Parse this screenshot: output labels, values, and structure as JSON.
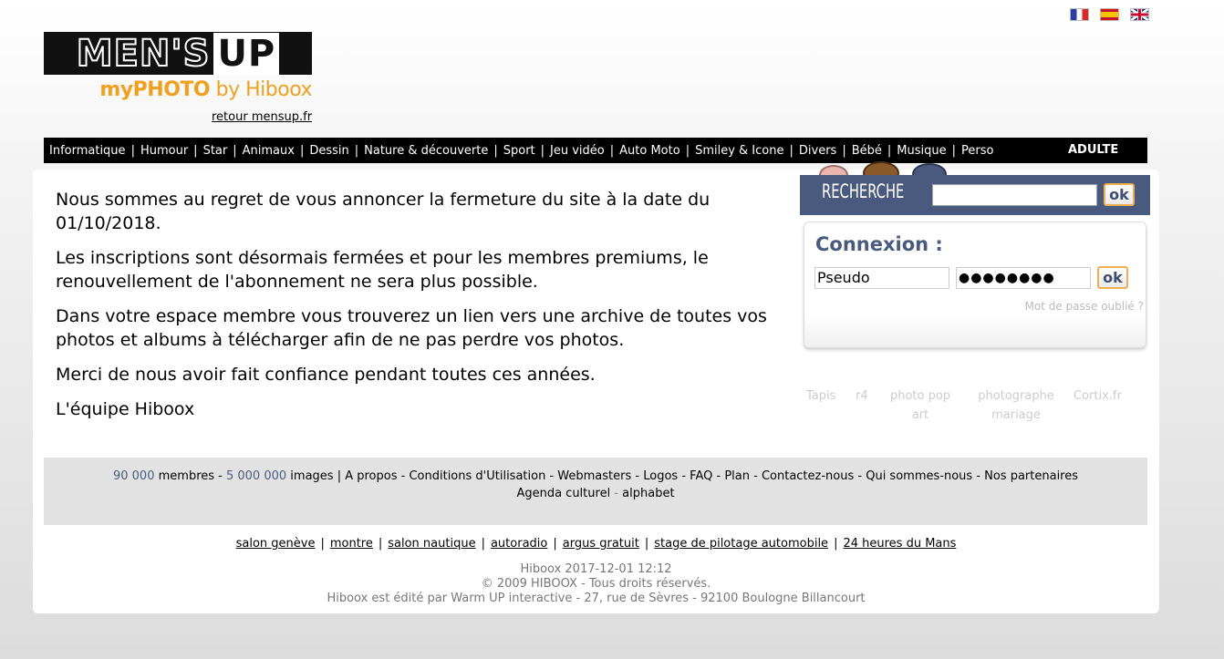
{
  "languages": [
    {
      "code": "fr",
      "icon": "french-flag-icon"
    },
    {
      "code": "es",
      "icon": "spanish-flag-icon"
    },
    {
      "code": "en",
      "icon": "uk-flag-icon"
    }
  ],
  "logo": {
    "brand_left": "MEN'S",
    "brand_right": "UP",
    "sub_my": "myPHOTO",
    "sub_by": " by Hiboox",
    "retour": "retour mensup.fr"
  },
  "nav": {
    "items": [
      "Informatique",
      "Humour",
      "Star",
      "Animaux",
      "Dessin",
      "Nature & découverte",
      "Sport",
      "Jeu vidéo",
      "Auto Moto",
      "Smiley & Icone",
      "Divers",
      "Bébé",
      "Musique",
      "Perso"
    ],
    "adult": "ADULTE"
  },
  "content": {
    "paragraphs": [
      "Nous sommes au regret de vous annoncer la fermeture du site à la date du 01/10/2018.",
      "Les inscriptions sont désormais fermées et pour les membres premiums, le renouvellement de l'abonnement ne sera plus possible.",
      "Dans votre espace membre vous trouverez un lien vers une archive de toutes vos photos et albums à télécharger afin de ne pas perdre vos photos.",
      "Merci de nous avoir fait confiance pendant toutes ces années.",
      "L'équipe Hiboox"
    ]
  },
  "search": {
    "label": "RECHERCHE",
    "value": "",
    "ok": "ok"
  },
  "login": {
    "title": "Connexion :",
    "pseudo": "Pseudo",
    "password_mask": "●●●●●●●●",
    "ok": "ok",
    "forgot": "Mot de passe oublié ?"
  },
  "partners": {
    "tapis": "Tapis",
    "r4": "r4",
    "photo_pop_1": "photo pop",
    "photo_pop_2": "art",
    "photographe_1": "photographe",
    "photographe_2": "mariage",
    "cortix": "Cortix.fr"
  },
  "footer": {
    "members_count": "90 000",
    "members_label": " membres - ",
    "images_count": "5 000 000",
    "images_label": " images",
    "links": [
      "A propos",
      "Conditions d'Utilisation",
      "Webmasters",
      "Logos",
      "FAQ",
      "Plan",
      "Contactez-nous",
      "Qui sommes-nous",
      "Nos partenaires"
    ],
    "agenda": "Agenda culturel",
    "alphabet": "alphabet",
    "bottom_links": [
      "salon genève",
      "montre",
      "salon nautique",
      "autoradio",
      "argus gratuit",
      "stage de pilotage automobile",
      "24 heures du Mans"
    ],
    "timestamp": "Hiboox 2017-12-01 12:12",
    "copyright": "© 2009 HIBOOX - Tous droits réservés.",
    "editor": "Hiboox est édité par Warm UP interactive - 27, rue de Sèvres - 92100 Boulogne Billancourt"
  },
  "colors": {
    "accent_blue": "#4a5a7e",
    "logo_orange": "#f0a020",
    "ok_border": "#f0b050"
  }
}
